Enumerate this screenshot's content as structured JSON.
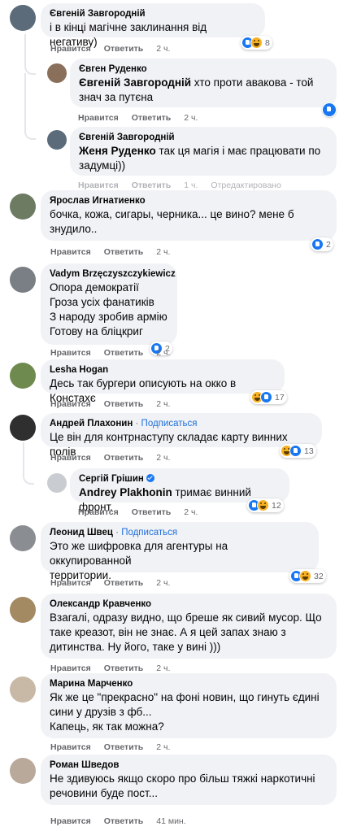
{
  "colors": {
    "bubble": "#f0f2f5",
    "link": "#216fdb",
    "meta": "#65676b",
    "like": "#1877f2",
    "haha": "#f7b125"
  },
  "actions": {
    "like": "Нравится",
    "reply": "Ответить",
    "edited": "Отредактировано"
  },
  "comments": [
    {
      "author": "Євгеній Завгородній",
      "text": "і в кінці магічне заклинання від негативу)",
      "time": "2 ч.",
      "reactions": [
        "like",
        "haha"
      ],
      "count": "8"
    },
    {
      "author": "Євген Руденко",
      "mention": "Євгеній Завгородній",
      "text": " хто проти авакова - той\nзнач за путєна",
      "time": "2 ч.",
      "reactions": [
        "like"
      ]
    },
    {
      "author": "Євгеній Завгородній",
      "mention": "Женя Руденко",
      "text": " так ця магія і має працювати по\nзадумці))",
      "time": "1 ч."
    },
    {
      "author": "Ярослав Игнатиенко",
      "text": "бочка, кожа, сигары, черника... це вино? мене б\nзнудило..",
      "time": "2 ч.",
      "reactions": [
        "like"
      ],
      "count": "2"
    },
    {
      "author": "Vadym Brzęczyszczykiewicz",
      "text": "Опора демократії\nГроза усіх фанатиків\nЗ народу зробив армію\nГотову на бліцкриг",
      "time": "2 ч.",
      "reactions": [
        "like"
      ],
      "count": "2"
    },
    {
      "author": "Lesha Hogan",
      "text": "Десь так бургери описують на окко в Констахє",
      "time": "2 ч.",
      "reactions": [
        "haha",
        "like"
      ],
      "count": "17"
    },
    {
      "author": "Андрей Плахонин",
      "follow": "Подписаться",
      "text": "Це він для контрнаступу складає карту винних полів",
      "time": "2 ч.",
      "reactions": [
        "haha",
        "like"
      ],
      "count": "13"
    },
    {
      "author": "Сергій Грішин",
      "mention": "Andrey Plakhonin",
      "text": " тримає винний фронт.",
      "time": "2 ч.",
      "reactions": [
        "like",
        "haha"
      ],
      "count": "12"
    },
    {
      "author": "Леонид Швец",
      "follow": "Подписаться",
      "text": "Это же шифровка для агентуры на оккупированной\nтерритории.",
      "time": "2 ч.",
      "reactions": [
        "like",
        "haha"
      ],
      "count": "32"
    },
    {
      "author": "Олександр Кравченко",
      "text": "Взагалі, одразу видно, що бреше як сивий мусор. Що\nтаке креазот, він не знає. А я цей запах знаю з\nдитинства. Ну його, таке у вині )))",
      "time": "2 ч."
    },
    {
      "author": "Марина Марченко",
      "text": "Як же це \"прекрасно\" на фоні новин, що гинуть єдині\nсини у друзів з фб...\nКапець, як так можна?",
      "time": "2 ч."
    },
    {
      "author": "Роман Шведов",
      "text": "Не здивуюсь якщо скоро про більш тяжкі наркотичні\nречовини буде пост...",
      "time": "41 мин."
    }
  ]
}
